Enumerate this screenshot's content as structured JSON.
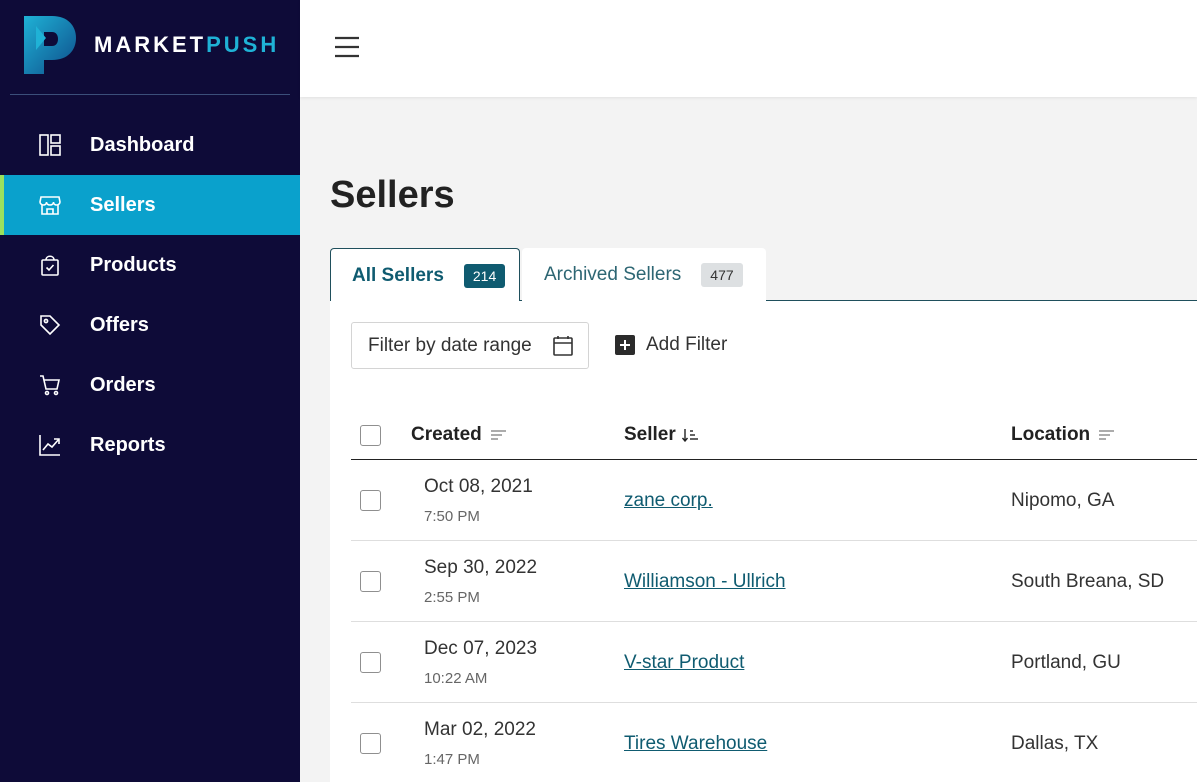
{
  "brand": {
    "name_part1": "MARKET",
    "name_part2": "PUSH"
  },
  "sidebar": {
    "items": [
      {
        "label": "Dashboard",
        "icon": "dashboard-icon"
      },
      {
        "label": "Sellers",
        "icon": "store-icon",
        "active": true
      },
      {
        "label": "Products",
        "icon": "shopping-bag-icon"
      },
      {
        "label": "Offers",
        "icon": "tag-icon"
      },
      {
        "label": "Orders",
        "icon": "cart-icon"
      },
      {
        "label": "Reports",
        "icon": "chart-icon"
      }
    ]
  },
  "colors": {
    "sidebar_bg": "#0e0b38",
    "active_bg": "#0aa1cc",
    "active_accent": "#9be15d",
    "primary": "#0f5b70",
    "brand_accent": "#1fb2d6"
  },
  "page": {
    "title": "Sellers"
  },
  "tabs": [
    {
      "label": "All Sellers",
      "count": "214",
      "active": true
    },
    {
      "label": "Archived Sellers",
      "count": "477"
    }
  ],
  "filters": {
    "date_range_placeholder": "Filter by date range",
    "add_filter_label": "Add Filter"
  },
  "table": {
    "columns": {
      "created": "Created",
      "seller": "Seller",
      "location": "Location"
    },
    "rows": [
      {
        "date": "Oct 08, 2021",
        "time": "7:50 PM",
        "seller": "zane corp.",
        "location": "Nipomo, GA"
      },
      {
        "date": "Sep 30, 2022",
        "time": "2:55 PM",
        "seller": "Williamson - Ullrich",
        "location": "South Breana, SD"
      },
      {
        "date": "Dec 07, 2023",
        "time": "10:22 AM",
        "seller": "V-star Product",
        "location": "Portland, GU"
      },
      {
        "date": "Mar 02, 2022",
        "time": "1:47 PM",
        "seller": "Tires Warehouse",
        "location": "Dallas, TX"
      }
    ]
  }
}
